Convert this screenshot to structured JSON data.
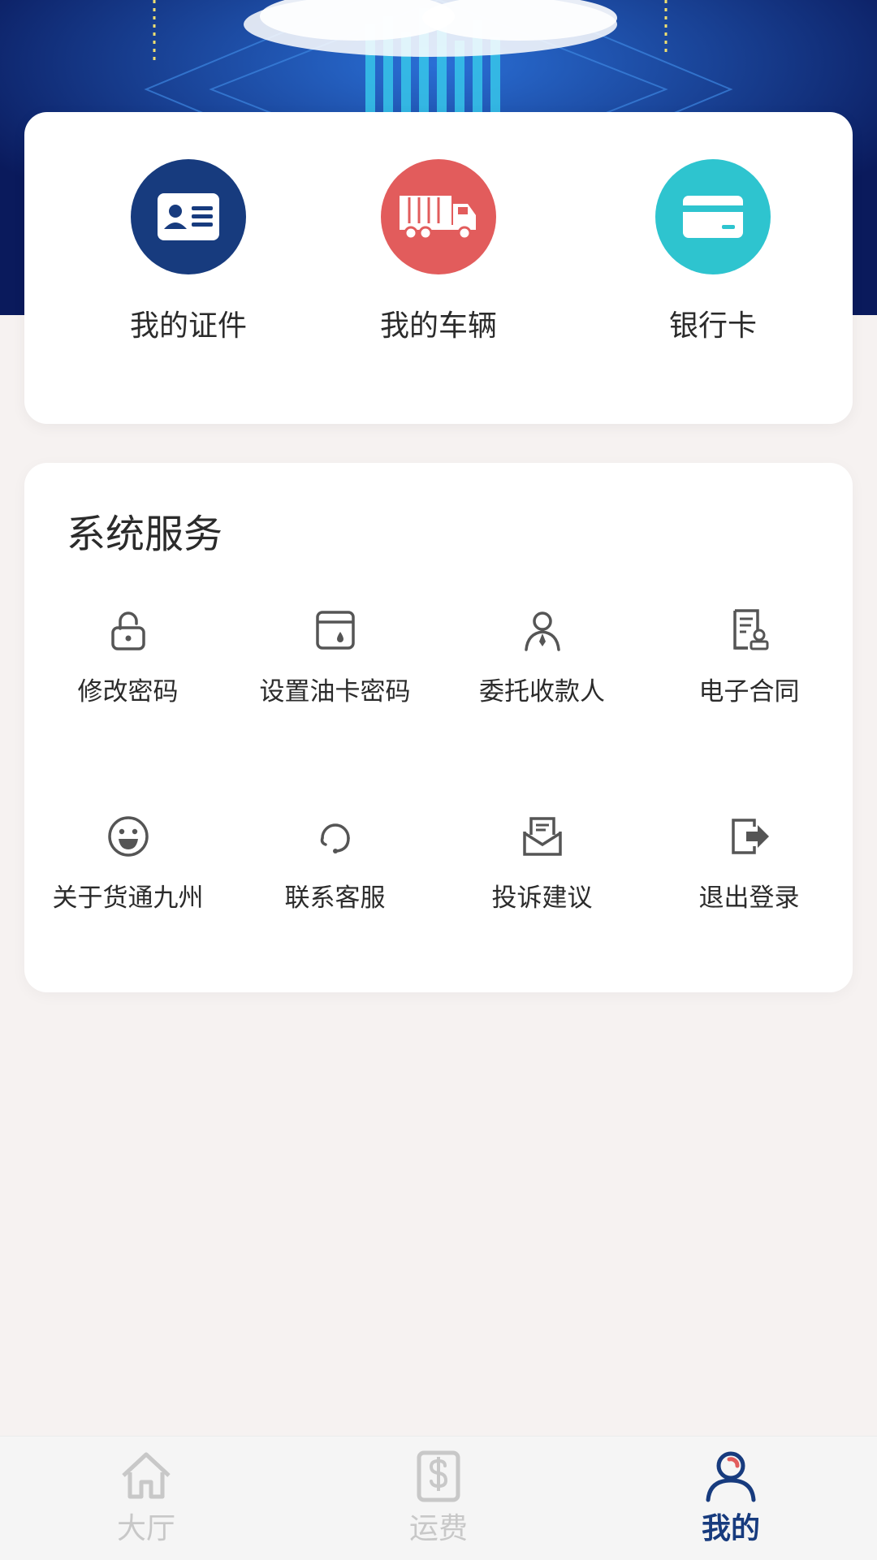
{
  "quick_actions": [
    {
      "label": "我的证件",
      "icon": "id-card-icon",
      "color": "#173b7e"
    },
    {
      "label": "我的车辆",
      "icon": "truck-icon",
      "color": "#e25c5c"
    },
    {
      "label": "银行卡",
      "icon": "bank-card-icon",
      "color": "#2ec4cf"
    }
  ],
  "services": {
    "title": "系统服务",
    "items": [
      {
        "label": "修改密码",
        "icon": "unlock-icon"
      },
      {
        "label": "设置油卡密码",
        "icon": "fuel-card-icon"
      },
      {
        "label": "委托收款人",
        "icon": "person-tie-icon"
      },
      {
        "label": "电子合同",
        "icon": "contract-icon"
      },
      {
        "label": "关于货通九州",
        "icon": "smiley-icon"
      },
      {
        "label": "联系客服",
        "icon": "headset-icon"
      },
      {
        "label": "投诉建议",
        "icon": "mail-open-icon"
      },
      {
        "label": "退出登录",
        "icon": "logout-icon"
      }
    ]
  },
  "tabbar": {
    "tabs": [
      {
        "label": "大厅",
        "icon": "home-icon",
        "active": false
      },
      {
        "label": "运费",
        "icon": "freight-fee-icon",
        "active": false
      },
      {
        "label": "我的",
        "icon": "user-icon",
        "active": true
      }
    ],
    "active_color": "#173b7e",
    "inactive_color": "#c8c8c8"
  }
}
